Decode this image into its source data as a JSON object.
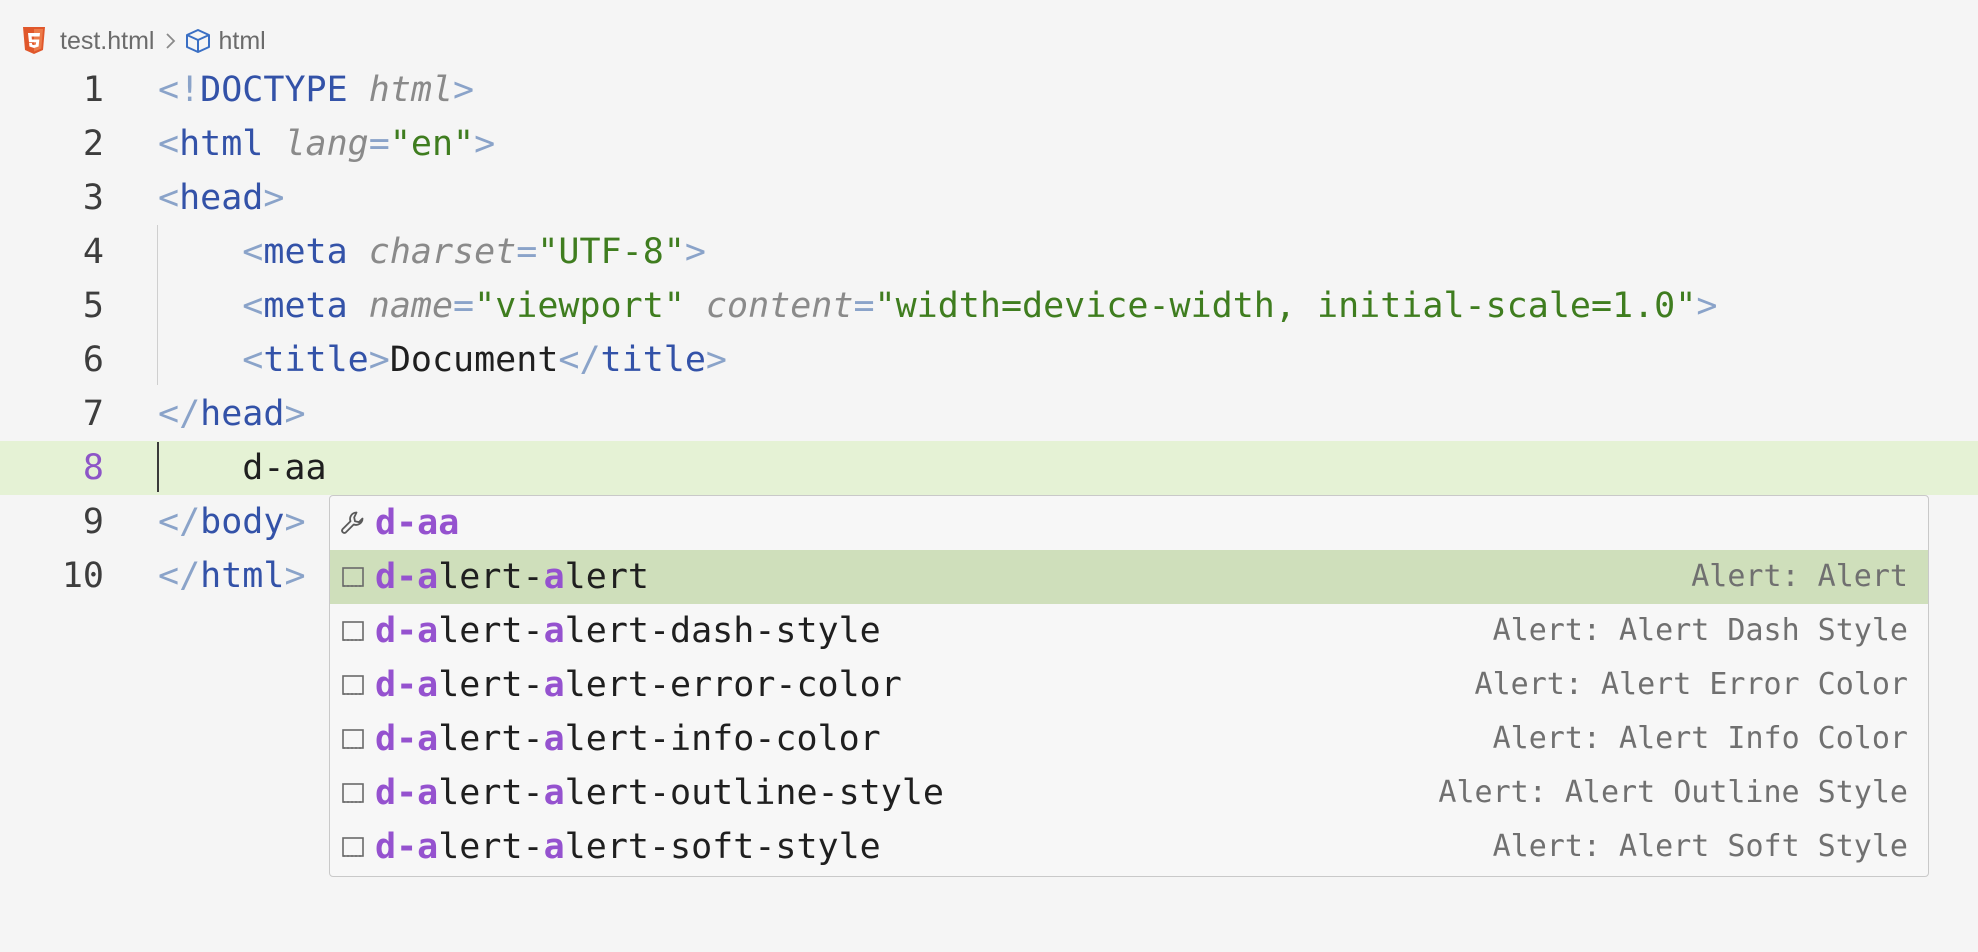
{
  "breadcrumb": {
    "file_icon": "html5-icon",
    "file": "test.html",
    "separator_icon": "chevron-right-icon",
    "symbol_icon": "cube-icon",
    "symbol": "html"
  },
  "editor": {
    "current_line": 8,
    "lines": [
      {
        "num": "1",
        "tokens": [
          [
            "punc",
            "<!"
          ],
          [
            "doctype",
            "DOCTYPE"
          ],
          [
            "text",
            " "
          ],
          [
            "attr",
            "html"
          ],
          [
            "punc",
            ">"
          ]
        ]
      },
      {
        "num": "2",
        "tokens": [
          [
            "punc",
            "<"
          ],
          [
            "tag",
            "html"
          ],
          [
            "text",
            " "
          ],
          [
            "attr",
            "lang"
          ],
          [
            "punc",
            "="
          ],
          [
            "str",
            "\"en\""
          ],
          [
            "punc",
            ">"
          ]
        ]
      },
      {
        "num": "3",
        "tokens": [
          [
            "punc",
            "<"
          ],
          [
            "tag",
            "head"
          ],
          [
            "punc",
            ">"
          ]
        ]
      },
      {
        "num": "4",
        "tokens": [
          [
            "text",
            "    "
          ],
          [
            "punc",
            "<"
          ],
          [
            "tag",
            "meta"
          ],
          [
            "text",
            " "
          ],
          [
            "attr",
            "charset"
          ],
          [
            "punc",
            "="
          ],
          [
            "str",
            "\"UTF-8\""
          ],
          [
            "punc",
            ">"
          ]
        ]
      },
      {
        "num": "5",
        "tokens": [
          [
            "text",
            "    "
          ],
          [
            "punc",
            "<"
          ],
          [
            "tag",
            "meta"
          ],
          [
            "text",
            " "
          ],
          [
            "attr",
            "name"
          ],
          [
            "punc",
            "="
          ],
          [
            "str",
            "\"viewport\""
          ],
          [
            "text",
            " "
          ],
          [
            "attr",
            "content"
          ],
          [
            "punc",
            "="
          ],
          [
            "str",
            "\"width=device-width, initial-scale=1.0\""
          ],
          [
            "punc",
            ">"
          ]
        ]
      },
      {
        "num": "6",
        "tokens": [
          [
            "text",
            "    "
          ],
          [
            "punc",
            "<"
          ],
          [
            "tag",
            "title"
          ],
          [
            "punc",
            ">"
          ],
          [
            "text",
            "Document"
          ],
          [
            "punc",
            "</"
          ],
          [
            "tag",
            "title"
          ],
          [
            "punc",
            ">"
          ]
        ]
      },
      {
        "num": "7",
        "tokens": [
          [
            "punc",
            "</"
          ],
          [
            "tag",
            "head"
          ],
          [
            "punc",
            ">"
          ]
        ]
      },
      {
        "num": "8",
        "tokens": [
          [
            "text",
            "    d-aa"
          ]
        ]
      },
      {
        "num": "9",
        "tokens": [
          [
            "punc",
            "</"
          ],
          [
            "tag",
            "body"
          ],
          [
            "punc",
            ">"
          ]
        ]
      },
      {
        "num": "10",
        "tokens": [
          [
            "punc",
            "</"
          ],
          [
            "tag",
            "html"
          ],
          [
            "punc",
            ">"
          ]
        ]
      }
    ]
  },
  "suggestions": {
    "query": "d-aa",
    "selected_index": 1,
    "items": [
      {
        "icon": "wrench-icon",
        "label": "d-aa",
        "detail": ""
      },
      {
        "icon": "snippet-icon",
        "label": "d-alert-alert",
        "detail": "Alert: Alert"
      },
      {
        "icon": "snippet-icon",
        "label": "d-alert-alert-dash-style",
        "detail": "Alert: Alert Dash Style"
      },
      {
        "icon": "snippet-icon",
        "label": "d-alert-alert-error-color",
        "detail": "Alert: Alert Error Color"
      },
      {
        "icon": "snippet-icon",
        "label": "d-alert-alert-info-color",
        "detail": "Alert: Alert Info Color"
      },
      {
        "icon": "snippet-icon",
        "label": "d-alert-alert-outline-style",
        "detail": "Alert: Alert Outline Style"
      },
      {
        "icon": "snippet-icon",
        "label": "d-alert-alert-soft-style",
        "detail": "Alert: Alert Soft Style"
      }
    ]
  },
  "colors": {
    "background": "#f5f5f5",
    "current_line": "#e5f2d5",
    "selected_suggestion": "#cfdfbb",
    "match_highlight": "#9552cf",
    "tag": "#3352a8",
    "punctuation": "#8aa3c9",
    "string": "#3f7d1f",
    "attribute": "#8a8a8a"
  }
}
